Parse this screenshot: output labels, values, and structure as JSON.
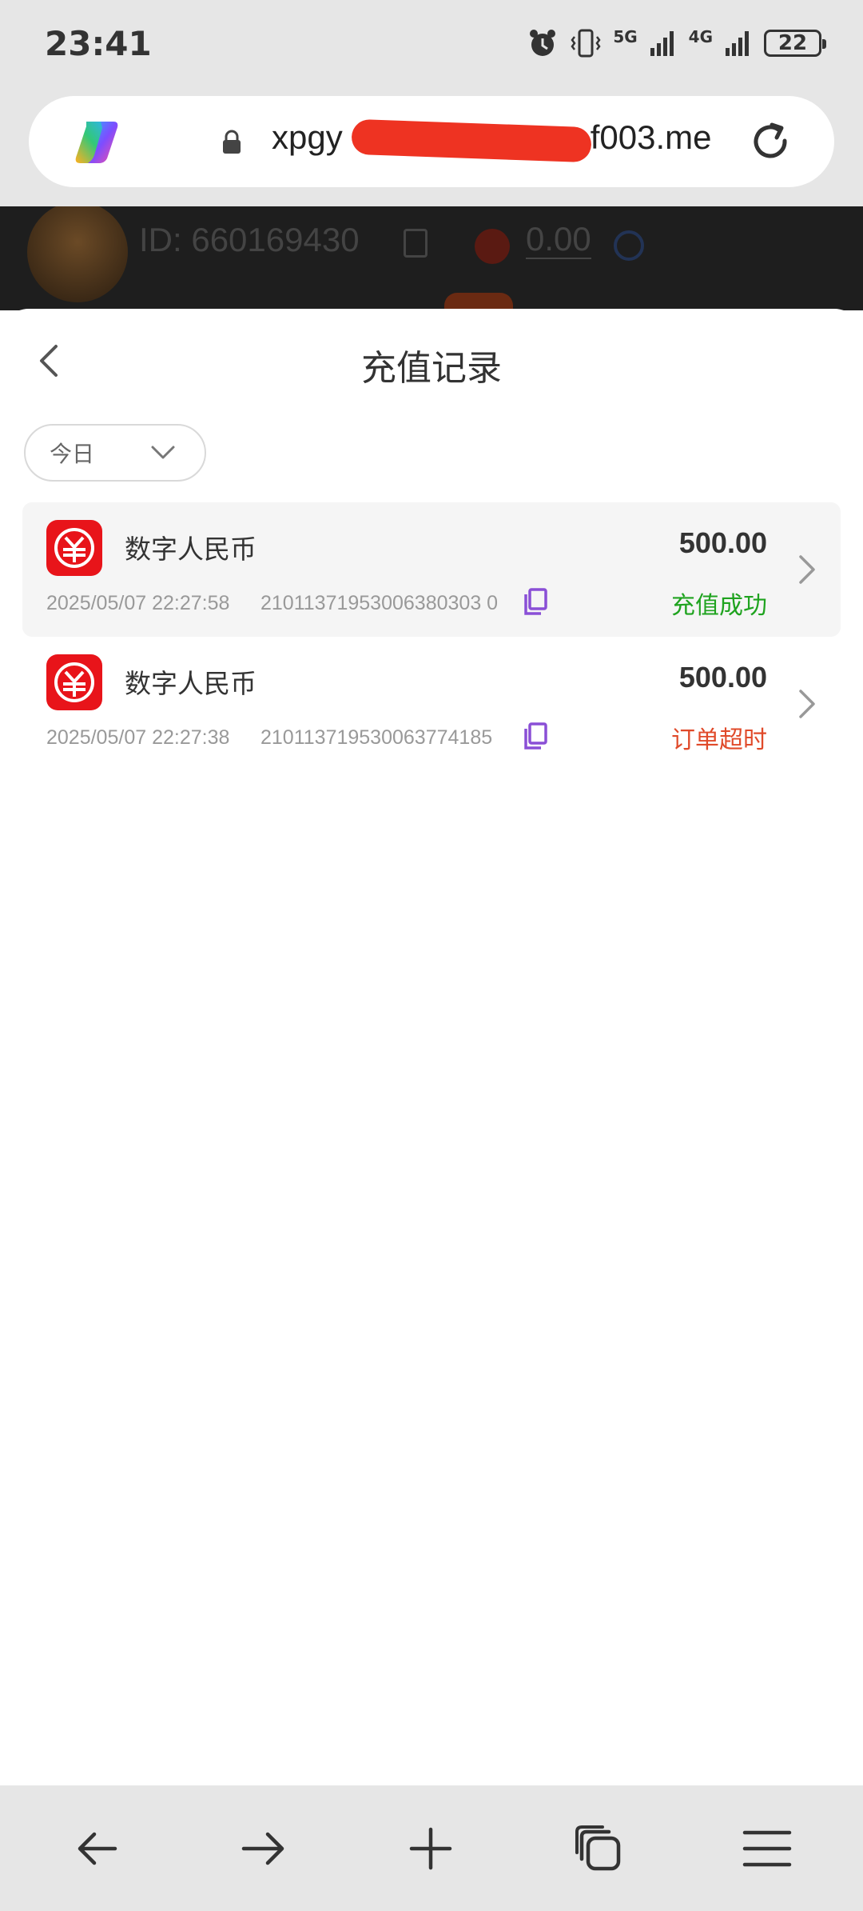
{
  "status_bar": {
    "time": "23:41",
    "network_1": "5G",
    "network_2": "4G",
    "battery": "22",
    "icons": [
      "alarm-icon",
      "vibrate-icon",
      "signal-icon",
      "signal-icon",
      "battery-icon"
    ]
  },
  "browser": {
    "url_visible_start": "xpgy",
    "url_visible_end": "f003.me",
    "icons": [
      "copilot-icon",
      "lock-icon",
      "reload-icon"
    ],
    "redaction_color": "#ee3322"
  },
  "background_page": {
    "user_id": "ID: 660169430",
    "balance": "0.00"
  },
  "sheet": {
    "title": "充值记录",
    "filter_label": "今日",
    "records": [
      {
        "name": "数字人民币",
        "amount": "500.00",
        "time": "2025/05/07 22:27:58",
        "order_no": "21011371953006380303 0",
        "status": "充值成功",
        "status_color": "#1fa31f"
      },
      {
        "name": "数字人民币",
        "amount": "500.00",
        "time": "2025/05/07 22:27:38",
        "order_no": "210113719530063774185",
        "status": "订单超时",
        "status_color": "#e04a2a"
      }
    ]
  },
  "bottom_nav": {
    "items": [
      "back-arrow-icon",
      "forward-arrow-icon",
      "new-tab-plus-icon",
      "tabs-icon",
      "menu-icon"
    ]
  },
  "colors": {
    "accent_copy_icon": "#8a4fd6",
    "ecny_red": "#e8141a"
  }
}
